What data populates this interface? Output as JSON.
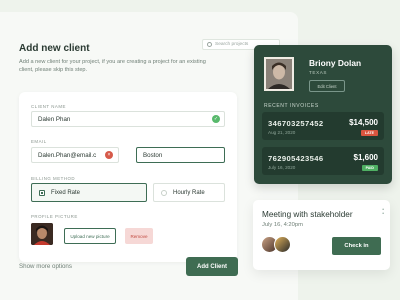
{
  "header": {
    "title": "Add new client",
    "subtitle": "Add a new client for your project, if you are creating a project for an existing client, please skip this step.",
    "search_placeholder": "Search projects"
  },
  "form": {
    "client_name_label": "CLIENT NAME",
    "client_name_value": "Dalen Phan",
    "email_label": "EMAIL",
    "email_value": "Dalen.Phan@email.c",
    "city_value": "Boston",
    "billing_label": "BILLING METHOD",
    "billing_options": [
      "Fixed Rate",
      "Hourly Rate"
    ],
    "billing_selected": "Fixed Rate",
    "picture_label": "PROFILE PICTURE",
    "upload_label": "Upload new picture",
    "remove_label": "Remove"
  },
  "footer": {
    "show_more": "Show more options",
    "add_client": "Add Client"
  },
  "profile": {
    "name": "Briony Dolan",
    "location": "TEXAS",
    "edit_label": "Edit Client",
    "invoices_title": "RECENT INVOICES",
    "invoices": [
      {
        "number": "346703257452",
        "date": "Aug 21, 2020",
        "amount": "$14,500",
        "status": "LATE",
        "status_color": "#d9553f"
      },
      {
        "number": "762905423546",
        "date": "July 16, 2020",
        "amount": "$1,600",
        "status": "PAID",
        "status_color": "#4fb063"
      }
    ]
  },
  "meeting": {
    "title": "Meeting with stakeholder",
    "time": "July 16, 4:20pm",
    "checkin_label": "Check in"
  },
  "colors": {
    "accent": "#3f6c52",
    "dark_card": "#2d4a3b",
    "success": "#58b96c",
    "error": "#d65a4a"
  }
}
